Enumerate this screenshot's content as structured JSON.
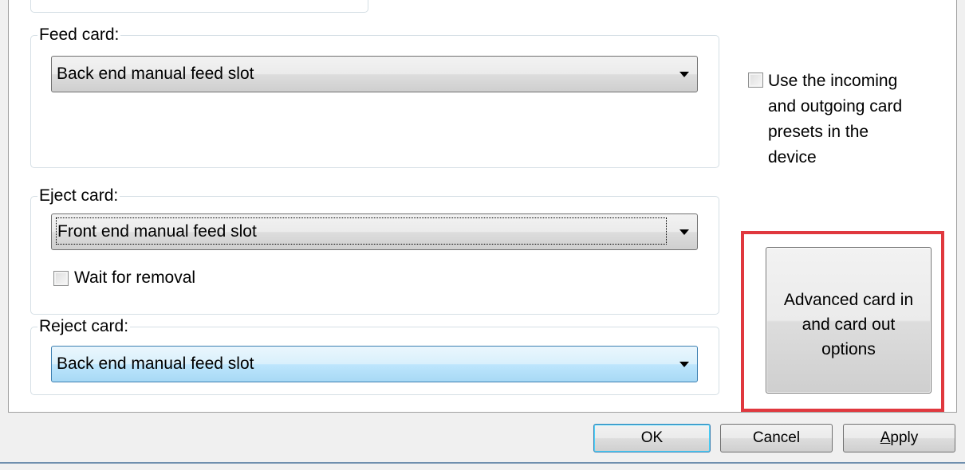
{
  "feed": {
    "label": "Feed card:",
    "selected": "Back end manual feed slot"
  },
  "eject": {
    "label": "Eject card:",
    "selected": "Front end manual feed slot",
    "wait_label": "Wait for removal",
    "wait_checked": false
  },
  "reject": {
    "label": "Reject card:",
    "selected": "Back end manual feed slot"
  },
  "presets": {
    "label_lines": [
      "Use the incoming",
      "and outgoing card",
      "presets in the",
      "device"
    ],
    "checked": false
  },
  "advanced": {
    "label_lines": [
      "Advanced card in",
      "and card out",
      "options"
    ]
  },
  "buttons": {
    "ok": "OK",
    "cancel": "Cancel",
    "apply_mnemonic": "A",
    "apply_rest": "pply"
  },
  "colors": {
    "highlight": "#e0383e",
    "focus_blue": "#3c7fb1"
  }
}
